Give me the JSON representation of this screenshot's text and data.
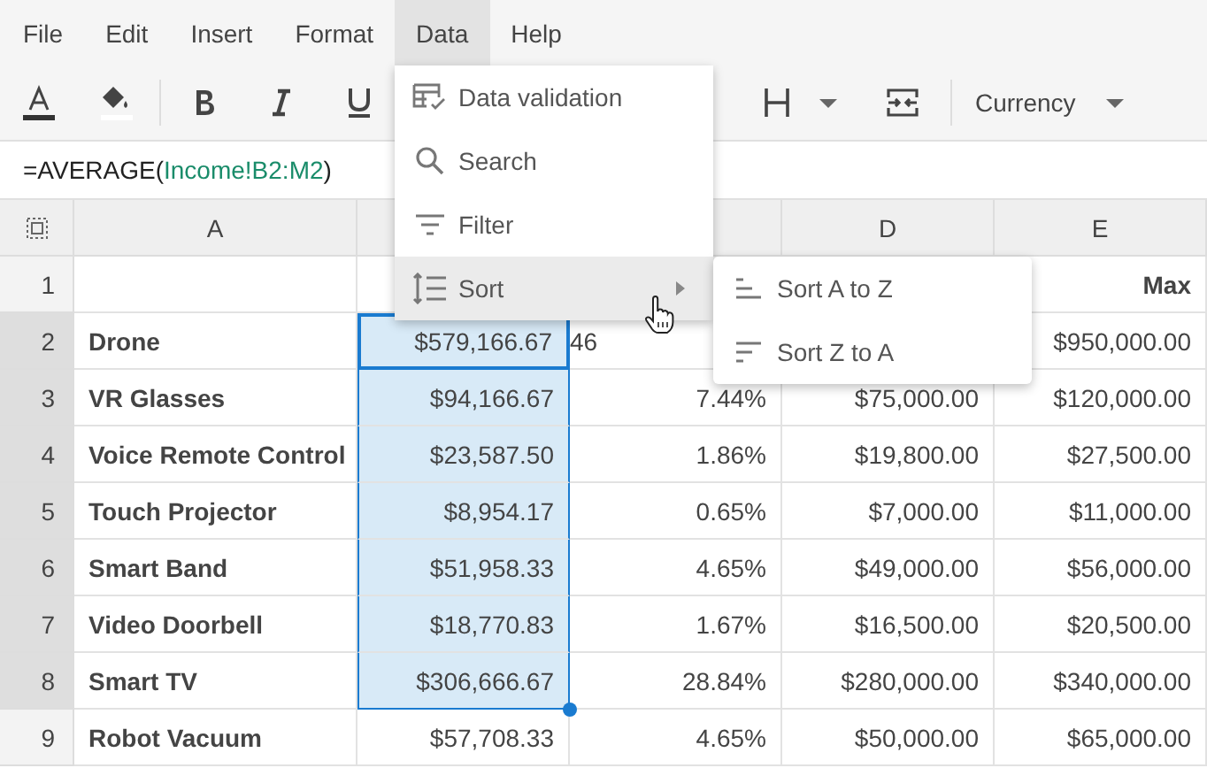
{
  "menubar": [
    {
      "label": "File",
      "selected": false
    },
    {
      "label": "Edit",
      "selected": false
    },
    {
      "label": "Insert",
      "selected": false
    },
    {
      "label": "Format",
      "selected": false
    },
    {
      "label": "Data",
      "selected": true
    },
    {
      "label": "Help",
      "selected": false
    }
  ],
  "toolbar": {
    "number_format": "Currency"
  },
  "formula": [
    {
      "text": "=AVERAGE(",
      "kind": "plain"
    },
    {
      "text": "Income!B2:M2",
      "kind": "ref"
    },
    {
      "text": ")",
      "kind": "plain"
    }
  ],
  "columns": [
    {
      "label": "A"
    },
    {},
    {},
    {
      "label": "D"
    },
    {
      "label": "E"
    }
  ],
  "rows": [
    {
      "number": "1",
      "selected": false,
      "kind": "header",
      "cells": [
        {
          "selected": false
        },
        {},
        {},
        {},
        {
          "text": "Max",
          "selected": false
        }
      ]
    },
    {
      "number": "2",
      "selected": true,
      "cells": [
        {
          "text": "Drone",
          "selected": false
        },
        {
          "text": "$579,166.67",
          "selected": true,
          "active": true
        },
        {
          "text": "46",
          "selected": false,
          "cut": true
        },
        {},
        {
          "text": "$950,000.00",
          "selected": false
        }
      ]
    },
    {
      "number": "3",
      "selected": true,
      "cells": [
        {
          "text": "VR Glasses",
          "selected": false
        },
        {
          "text": "$94,166.67",
          "selected": true
        },
        {
          "text": "7.44%",
          "selected": false
        },
        {
          "text": "$75,000.00",
          "selected": false
        },
        {
          "text": "$120,000.00",
          "selected": false
        }
      ]
    },
    {
      "number": "4",
      "selected": true,
      "cells": [
        {
          "text": "Voice Remote Control",
          "selected": false
        },
        {
          "text": "$23,587.50",
          "selected": true
        },
        {
          "text": "1.86%",
          "selected": false
        },
        {
          "text": "$19,800.00",
          "selected": false
        },
        {
          "text": "$27,500.00",
          "selected": false
        }
      ]
    },
    {
      "number": "5",
      "selected": true,
      "cells": [
        {
          "text": "Touch Projector",
          "selected": false
        },
        {
          "text": "$8,954.17",
          "selected": true
        },
        {
          "text": "0.65%",
          "selected": false
        },
        {
          "text": "$7,000.00",
          "selected": false
        },
        {
          "text": "$11,000.00",
          "selected": false
        }
      ]
    },
    {
      "number": "6",
      "selected": true,
      "cells": [
        {
          "text": "Smart Band",
          "selected": false
        },
        {
          "text": "$51,958.33",
          "selected": true
        },
        {
          "text": "4.65%",
          "selected": false
        },
        {
          "text": "$49,000.00",
          "selected": false
        },
        {
          "text": "$56,000.00",
          "selected": false
        }
      ]
    },
    {
      "number": "7",
      "selected": true,
      "cells": [
        {
          "text": "Video Doorbell",
          "selected": false
        },
        {
          "text": "$18,770.83",
          "selected": true
        },
        {
          "text": "1.67%",
          "selected": false
        },
        {
          "text": "$16,500.00",
          "selected": false
        },
        {
          "text": "$20,500.00",
          "selected": false
        }
      ]
    },
    {
      "number": "8",
      "selected": true,
      "cells": [
        {
          "text": "Smart TV",
          "selected": false
        },
        {
          "text": "$306,666.67",
          "selected": true
        },
        {
          "text": "28.84%",
          "selected": false
        },
        {
          "text": "$280,000.00",
          "selected": false
        },
        {
          "text": "$340,000.00",
          "selected": false
        }
      ]
    },
    {
      "number": "9",
      "selected": false,
      "cells": [
        {
          "text": "Robot Vacuum",
          "selected": false
        },
        {
          "text": "$57,708.33",
          "selected": false
        },
        {
          "text": "4.65%",
          "selected": false
        },
        {
          "text": "$50,000.00",
          "selected": false
        },
        {
          "text": "$65,000.00",
          "selected": false
        }
      ]
    }
  ],
  "data_menu": [
    {
      "label": "Data validation",
      "kind": "validation",
      "selected": false
    },
    {
      "label": "Search",
      "kind": "search",
      "selected": false
    },
    {
      "label": "Filter",
      "kind": "filter",
      "selected": false
    },
    {
      "label": "Sort",
      "kind": "sort",
      "selected": true,
      "submenu": true
    }
  ],
  "sort_submenu": [
    {
      "label": "Sort A to Z",
      "kind": "asc"
    },
    {
      "label": "Sort Z to A",
      "kind": "desc"
    }
  ]
}
